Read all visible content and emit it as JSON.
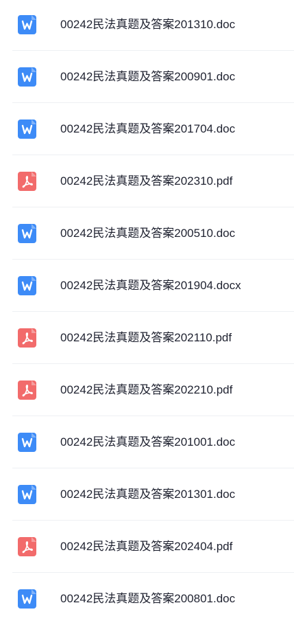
{
  "files": [
    {
      "name": "00242民法真题及答案201310.doc",
      "icon": "word-icon"
    },
    {
      "name": "00242民法真题及答案200901.doc",
      "icon": "word-icon"
    },
    {
      "name": "00242民法真题及答案201704.doc",
      "icon": "word-icon"
    },
    {
      "name": "00242民法真题及答案202310.pdf",
      "icon": "pdf-icon"
    },
    {
      "name": "00242民法真题及答案200510.doc",
      "icon": "word-icon"
    },
    {
      "name": "00242民法真题及答案201904.docx",
      "icon": "word-icon"
    },
    {
      "name": "00242民法真题及答案202110.pdf",
      "icon": "pdf-icon"
    },
    {
      "name": "00242民法真题及答案202210.pdf",
      "icon": "pdf-icon"
    },
    {
      "name": "00242民法真题及答案201001.doc",
      "icon": "word-icon"
    },
    {
      "name": "00242民法真题及答案201301.doc",
      "icon": "word-icon"
    },
    {
      "name": "00242民法真题及答案202404.pdf",
      "icon": "pdf-icon"
    },
    {
      "name": "00242民法真题及答案200801.doc",
      "icon": "word-icon"
    }
  ],
  "colors": {
    "word": "#3d8bf7",
    "pdf": "#f26b6b",
    "text": "#1f2230",
    "divider": "#eef0f3"
  }
}
